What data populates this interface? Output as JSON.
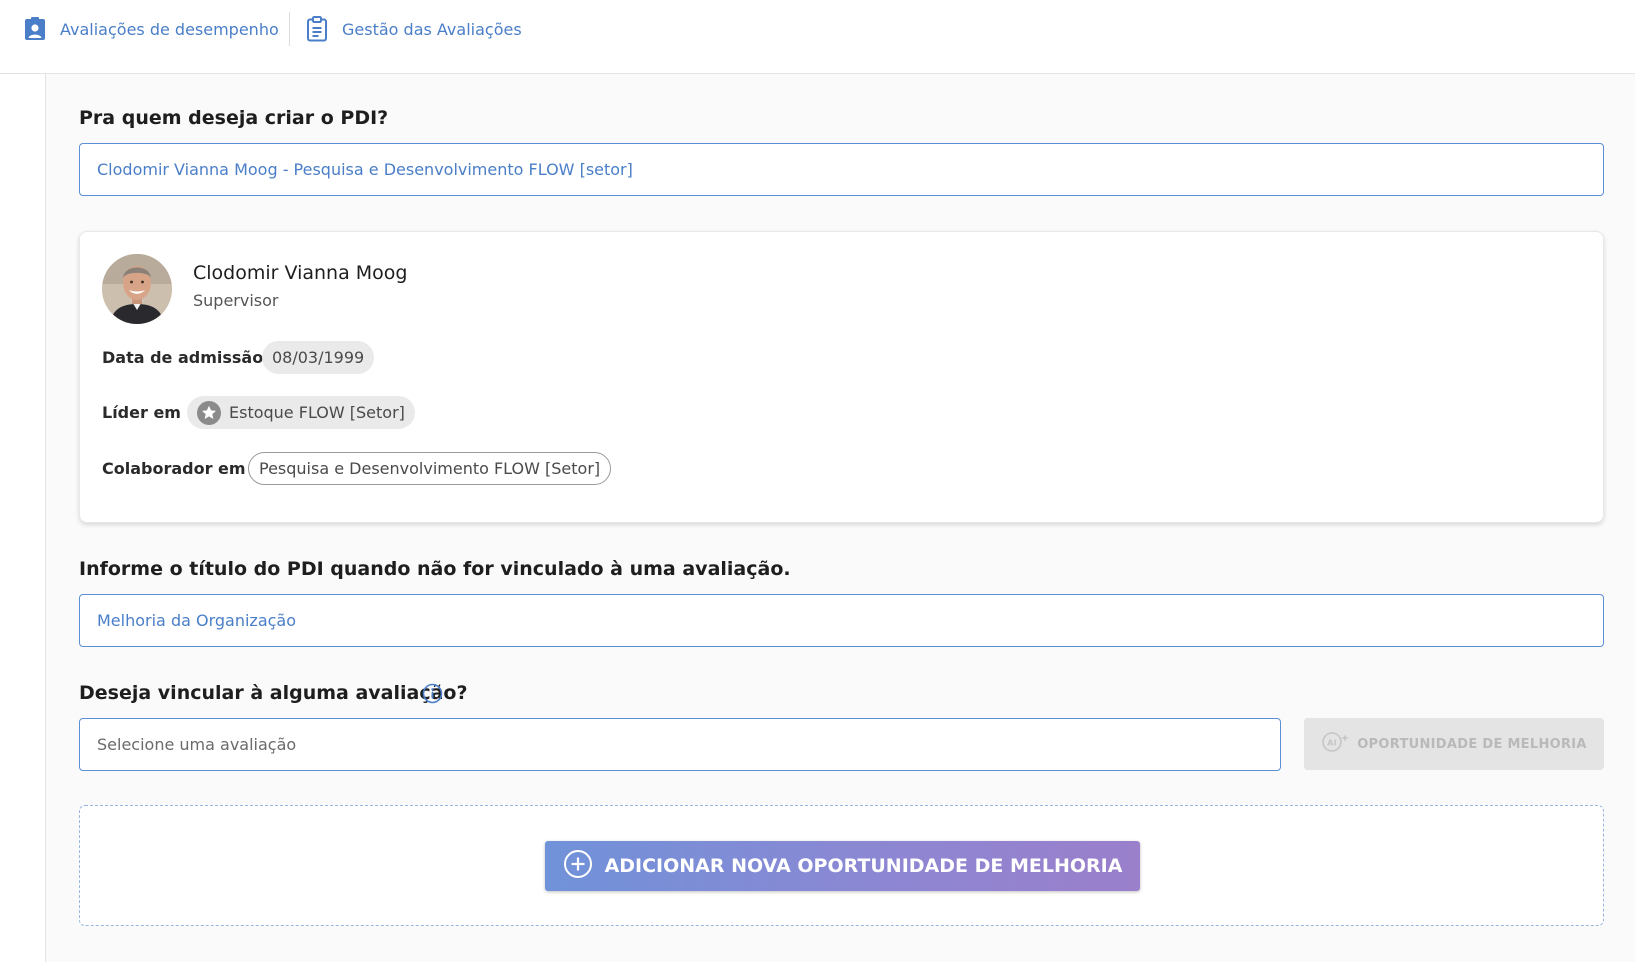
{
  "breadcrumb": {
    "items": [
      {
        "label": "Avaliações de desempenho",
        "icon": "person-badge-icon"
      },
      {
        "label": "Gestão das Avaliações",
        "icon": "clipboard-icon"
      }
    ]
  },
  "target": {
    "label": "Pra quem deseja criar o PDI?",
    "value": "Clodomir Vianna Moog - Pesquisa e Desenvolvimento FLOW [setor]"
  },
  "profile": {
    "name": "Clodomir Vianna Moog",
    "role": "Supervisor",
    "admission_label": "Data de admissão",
    "admission_date": "08/03/1999",
    "leader_label": "Líder em",
    "leader_of": "Estoque FLOW [Setor]",
    "collaborator_label": "Colaborador em",
    "collaborator_in": "Pesquisa e Desenvolvimento FLOW [Setor]"
  },
  "title_field": {
    "label": "Informe o título do PDI quando não for vinculado à uma avaliação.",
    "value": "Melhoria da Organização"
  },
  "evaluation": {
    "label": "Deseja vincular à alguma avaliação?",
    "placeholder": "Selecione uma avaliação",
    "ai_button_label": "OPORTUNIDADE DE MELHORIA"
  },
  "actions": {
    "add_label": "ADICIONAR NOVA OPORTUNIDADE DE MELHORIA"
  },
  "colors": {
    "accent": "#4a7ec8",
    "field_border": "#5b8ed4",
    "button_gradient_start": "#7092d9",
    "button_gradient_end": "#9a7fcb"
  }
}
